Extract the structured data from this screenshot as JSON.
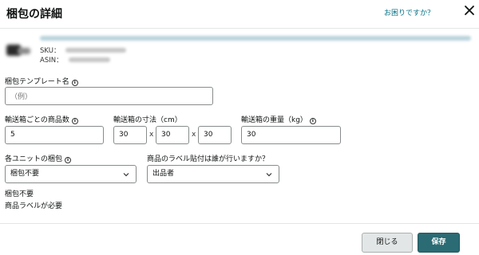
{
  "header": {
    "title": "梱包の詳細",
    "help_link": "お困りですか？"
  },
  "product": {
    "sku_label": "SKU：",
    "asin_label": "ASIN："
  },
  "form": {
    "template_name": {
      "label": "梱包テンプレート名",
      "placeholder": "（例）"
    },
    "units_per_box": {
      "label": "輸送箱ごとの商品数",
      "value": "5"
    },
    "box_dims": {
      "label": "輸送箱の寸法（cm）",
      "length": "30",
      "width": "30",
      "height": "30",
      "separator": "x"
    },
    "box_weight": {
      "label": "輸送箱の重量（kg）",
      "value": "30"
    },
    "unit_prep": {
      "label": "各ユニットの梱包",
      "selected": "梱包不要"
    },
    "labeling": {
      "label": "商品のラベル貼付は誰が行いますか？",
      "selected": "出品者"
    }
  },
  "summary": {
    "line1": "梱包不要",
    "line2": "商品ラベルが必要"
  },
  "footer": {
    "close_label": "閉じる",
    "save_label": "保存"
  },
  "icons": {
    "info": "info-icon",
    "close": "close-icon",
    "chevron": "chevron-down-icon"
  },
  "colors": {
    "link": "#007185",
    "primary_button": "#2b6b73"
  }
}
